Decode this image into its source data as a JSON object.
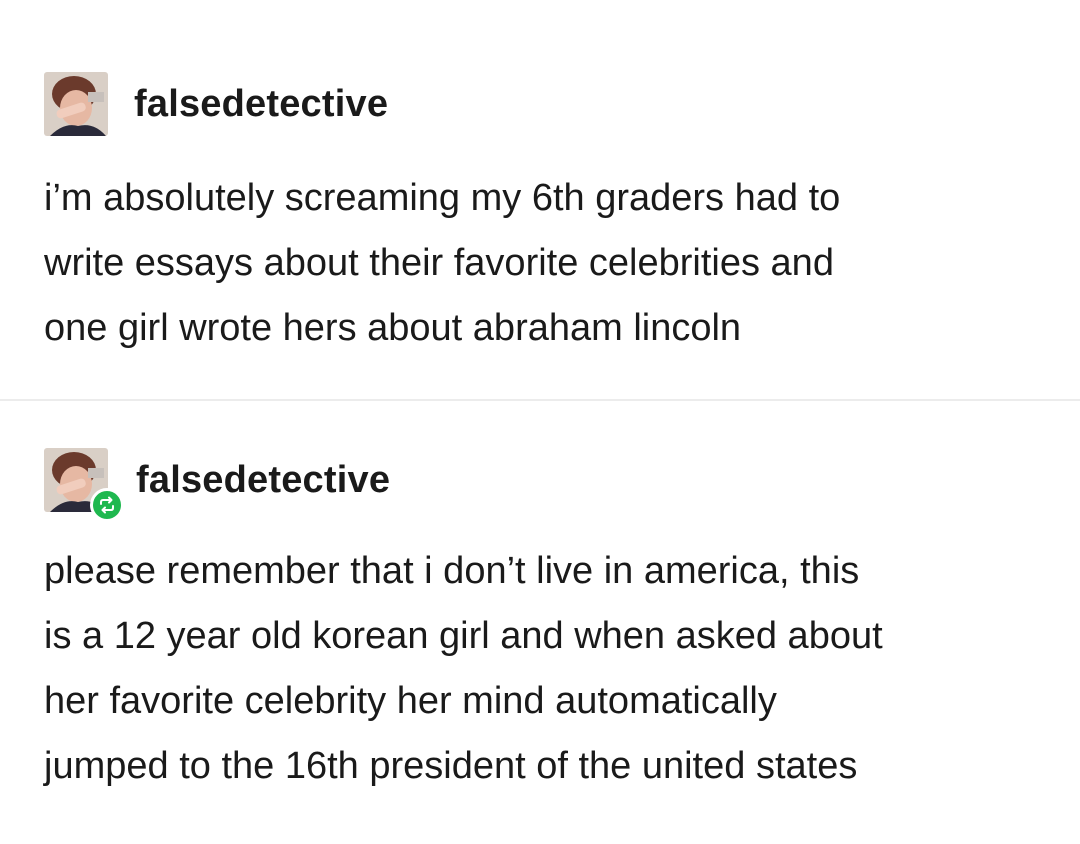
{
  "posts": [
    {
      "username": "falsedetective",
      "avatar_icon": "user-avatar-icon",
      "lines": [
        "i’m absolutely screaming my 6th graders had to",
        "write essays about their favorite celebrities and",
        "one girl wrote hers about abraham lincoln"
      ]
    },
    {
      "username": "falsedetective",
      "avatar_icon": "user-avatar-icon",
      "badge_icon": "reblog-icon",
      "lines": [
        "please remember that i don’t live in america, this",
        "is a 12 year old korean girl and when asked about",
        "her favorite celebrity her mind automatically",
        "jumped to the 16th president of the united states"
      ]
    }
  ],
  "colors": {
    "background": "#ffffff",
    "text": "#1a1a1a",
    "divider": "#ececec",
    "reblog_badge": "#1fb84f"
  }
}
